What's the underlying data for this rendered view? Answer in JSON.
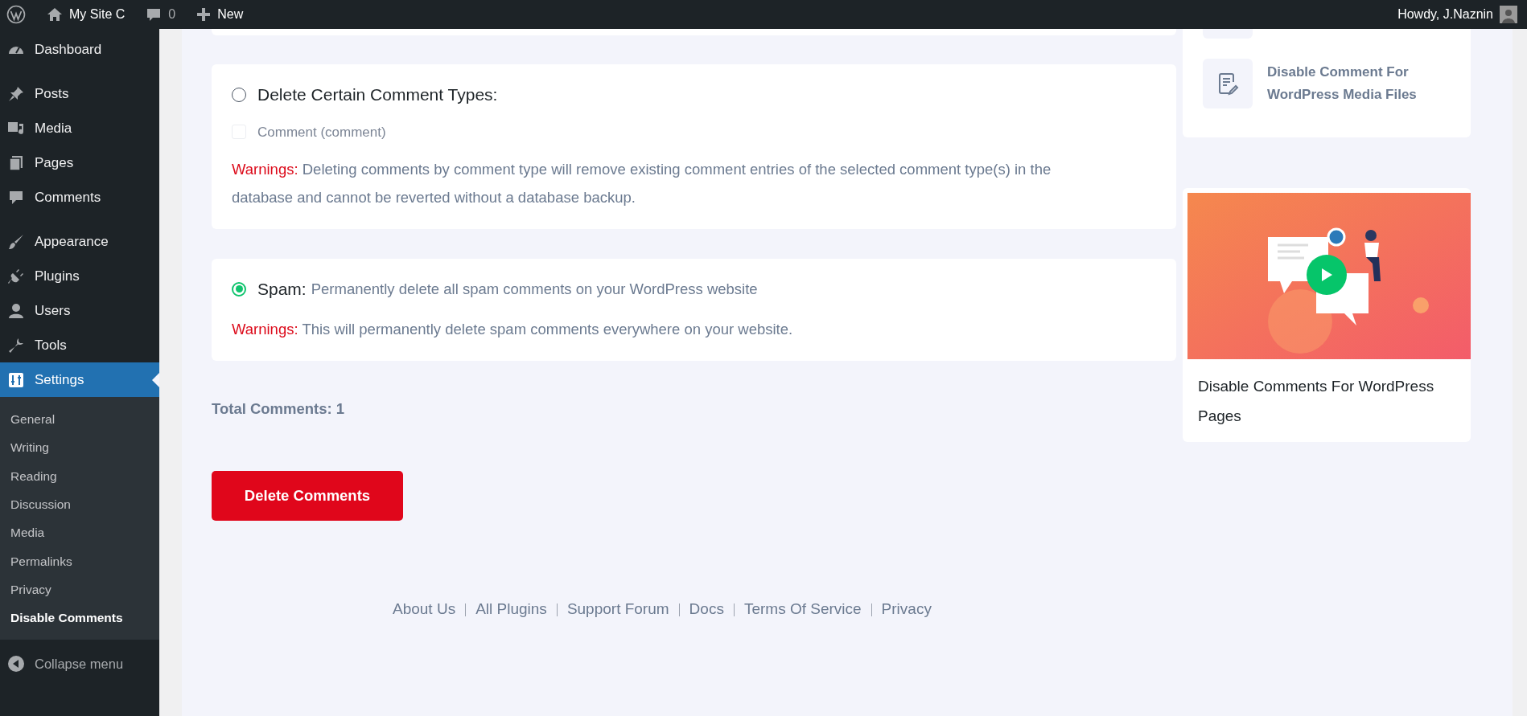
{
  "admin_bar": {
    "items": [
      {
        "kind": "wp-logo"
      },
      {
        "kind": "home",
        "label": "My Site C"
      },
      {
        "kind": "comments",
        "label": "0"
      },
      {
        "kind": "new",
        "label": "New"
      }
    ],
    "greeting": "Howdy, J.Naznin"
  },
  "sidebar": {
    "groups": [
      [
        {
          "kind": "dashboard",
          "label": "Dashboard",
          "selected": false
        }
      ],
      [
        {
          "kind": "pin",
          "label": "Posts",
          "selected": false
        },
        {
          "kind": "media",
          "label": "Media",
          "selected": false
        },
        {
          "kind": "pages",
          "label": "Pages",
          "selected": false
        },
        {
          "kind": "comment",
          "label": "Comments",
          "selected": false
        }
      ],
      [
        {
          "kind": "brush",
          "label": "Appearance",
          "selected": false
        },
        {
          "kind": "plug",
          "label": "Plugins",
          "selected": false
        },
        {
          "kind": "user",
          "label": "Users",
          "selected": false
        },
        {
          "kind": "wrench",
          "label": "Tools",
          "selected": false
        },
        {
          "kind": "settings",
          "label": "Settings",
          "selected": true,
          "children": [
            {
              "label": "General",
              "selected": false
            },
            {
              "label": "Writing",
              "selected": false
            },
            {
              "label": "Reading",
              "selected": false
            },
            {
              "label": "Discussion",
              "selected": false
            },
            {
              "label": "Media",
              "selected": false
            },
            {
              "label": "Permalinks",
              "selected": false
            },
            {
              "label": "Privacy",
              "selected": false
            },
            {
              "label": "Disable Comments",
              "selected": true
            }
          ]
        }
      ]
    ],
    "collapse": "Collapse menu"
  },
  "options": [
    {
      "kind": "types",
      "selected": false,
      "title": "Delete Certain Comment Types:",
      "checkboxes": [
        {
          "label": "Comment (comment)",
          "checked": false,
          "disabled": true
        }
      ],
      "warning_label": "Warnings:",
      "warning": "Deleting comments by comment type will remove existing comment entries of the selected comment type(s) in the database and cannot be reverted without a database backup."
    },
    {
      "kind": "spam",
      "selected": true,
      "title": "Spam:",
      "description": "Permanently delete all spam comments on your WordPress website",
      "warning_label": "Warnings:",
      "warning": "This will permanently delete spam comments everywhere on your website."
    }
  ],
  "total": "Total Comments: 1",
  "delete_button": "Delete Comments",
  "footer_links": [
    "About Us",
    "All Plugins",
    "Support Forum",
    "Docs",
    "Terms Of Service",
    "Privacy"
  ],
  "related": [
    {
      "title": "Disable Comment For WordPress Media Files"
    }
  ],
  "video": {
    "kind": "picture",
    "title": "Disable Comments For WordPress Pages"
  }
}
